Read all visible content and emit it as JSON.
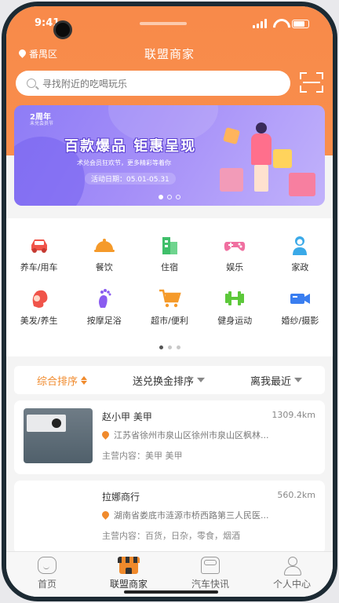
{
  "status": {
    "time": "9:41"
  },
  "header": {
    "location": "番禺区",
    "title": "联盟商家"
  },
  "search": {
    "placeholder": "寻找附近的吃喝玩乐"
  },
  "banner": {
    "badge": "2周年",
    "badge_sub": "未兑会员节",
    "headline": "百款爆品 钜惠呈现",
    "subline": "术兑会员狂欢节，更多精彩等着你",
    "date": "活动日期：05.01-05.31",
    "slides": 3,
    "active_slide": 0
  },
  "categories": [
    {
      "label": "养车/用车",
      "icon": "car-icon",
      "color": "#f0544a"
    },
    {
      "label": "餐饮",
      "icon": "food-cloche-icon",
      "color": "#f59a2a"
    },
    {
      "label": "住宿",
      "icon": "building-icon",
      "color": "#3fbf6a"
    },
    {
      "label": "娱乐",
      "icon": "gamepad-icon",
      "color": "#f06fa0"
    },
    {
      "label": "家政",
      "icon": "housekeeper-icon",
      "color": "#3aa9e8"
    },
    {
      "label": "美发/养生",
      "icon": "hair-icon",
      "color": "#f0544a"
    },
    {
      "label": "按摩足浴",
      "icon": "foot-icon",
      "color": "#8a5cf0"
    },
    {
      "label": "超市/便利",
      "icon": "cart-icon",
      "color": "#f59a2a"
    },
    {
      "label": "健身运动",
      "icon": "dumbbell-icon",
      "color": "#5cc83a"
    },
    {
      "label": "婚纱/摄影",
      "icon": "camera-icon",
      "color": "#3a7ef0"
    }
  ],
  "sort": {
    "items": [
      "综合排序",
      "送兑换金排序",
      "离我最近"
    ],
    "active": 0
  },
  "merchants": [
    {
      "name": "赵小甲 美甲",
      "distance": "1309.4km",
      "address": "江苏省徐州市泉山区徐州市泉山区枫林...",
      "business": "主营内容：美甲 美甲"
    },
    {
      "name": "拉娜商行",
      "distance": "560.2km",
      "address": "湖南省娄底市涟源市桥西路第三人民医...",
      "business": "主营内容：百货，日杂，零食，烟酒"
    }
  ],
  "nav": {
    "items": [
      {
        "label": "首页",
        "icon": "home-icon"
      },
      {
        "label": "联盟商家",
        "icon": "store-icon"
      },
      {
        "label": "汽车快讯",
        "icon": "car-icon"
      },
      {
        "label": "个人中心",
        "icon": "user-icon"
      }
    ],
    "active": 1
  },
  "colors": {
    "accent": "#f98e4c",
    "banner": "#9d88f7",
    "active_text": "#f08a2c"
  }
}
